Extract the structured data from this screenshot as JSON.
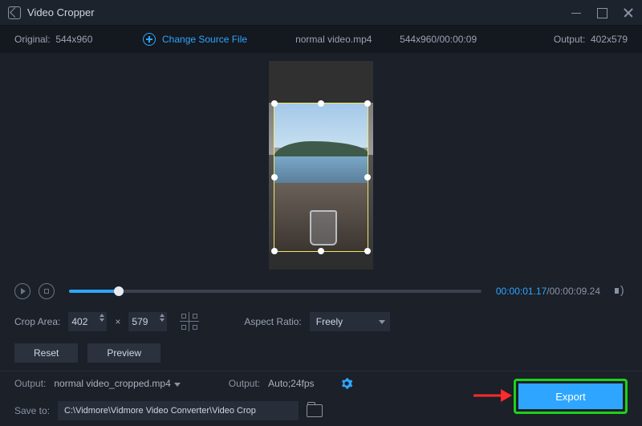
{
  "window": {
    "title": "Video Cropper"
  },
  "infobar": {
    "original_label": "Original:",
    "original_dims": "544x960",
    "change_source": "Change Source File",
    "filename": "normal video.mp4",
    "src_dims_time": "544x960/00:00:09",
    "output_label": "Output:",
    "output_dims": "402x579"
  },
  "player": {
    "current_time": "00:00:01.17",
    "total_time": "00:00:09.24"
  },
  "crop": {
    "area_label": "Crop Area:",
    "width": "402",
    "height": "579",
    "aspect_label": "Aspect Ratio:",
    "aspect_value": "Freely"
  },
  "buttons": {
    "reset": "Reset",
    "preview": "Preview",
    "export": "Export"
  },
  "output": {
    "file_label": "Output:",
    "file_value": "normal video_cropped.mp4",
    "fmt_label": "Output:",
    "fmt_value": "Auto;24fps"
  },
  "save": {
    "label": "Save to:",
    "path": "C:\\Vidmore\\Vidmore Video Converter\\Video Crop"
  }
}
